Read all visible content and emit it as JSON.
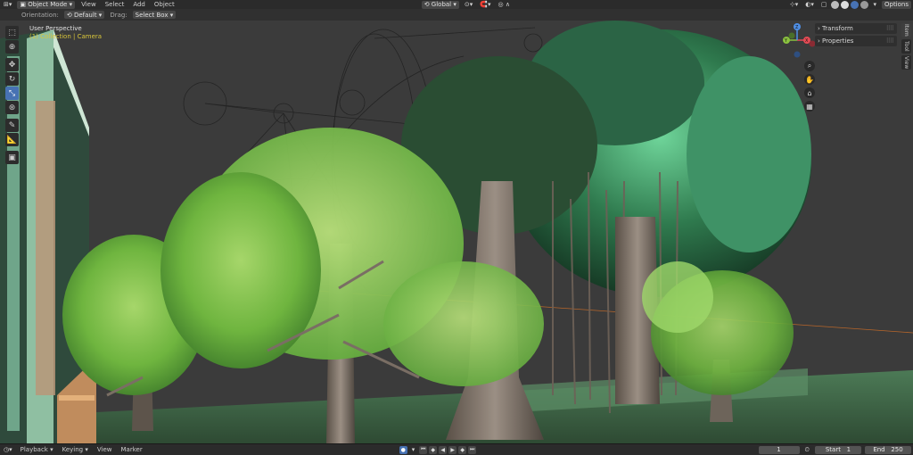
{
  "topbar": {
    "mode": "Object Mode",
    "menus": [
      "View",
      "Select",
      "Add",
      "Object"
    ],
    "transform_orientation": "Global",
    "options": "Options"
  },
  "tool_header": {
    "orientation_label": "Orientation:",
    "orientation_value": "Default",
    "drag_label": "Drag:",
    "drag_value": "Select Box"
  },
  "viewport": {
    "view_name": "User Perspective",
    "collection_info": "(1) Collection | Camera"
  },
  "npanel": {
    "sections": [
      "Transform",
      "Properties"
    ],
    "tabs": [
      "Item",
      "Tool",
      "View"
    ]
  },
  "gizmo": {
    "x": "X",
    "y": "Y",
    "z": "Z"
  },
  "timeline": {
    "menus": [
      "Playback",
      "Keying",
      "View",
      "Marker"
    ],
    "current_frame": "1",
    "start_label": "Start",
    "start": "1",
    "end_label": "End",
    "end": "250"
  },
  "colors": {
    "accent": "#4772b3",
    "x_axis": "#e64b55",
    "y_axis": "#8bc23f",
    "z_axis": "#4f8fe6",
    "collection_text": "#d9c63a"
  }
}
